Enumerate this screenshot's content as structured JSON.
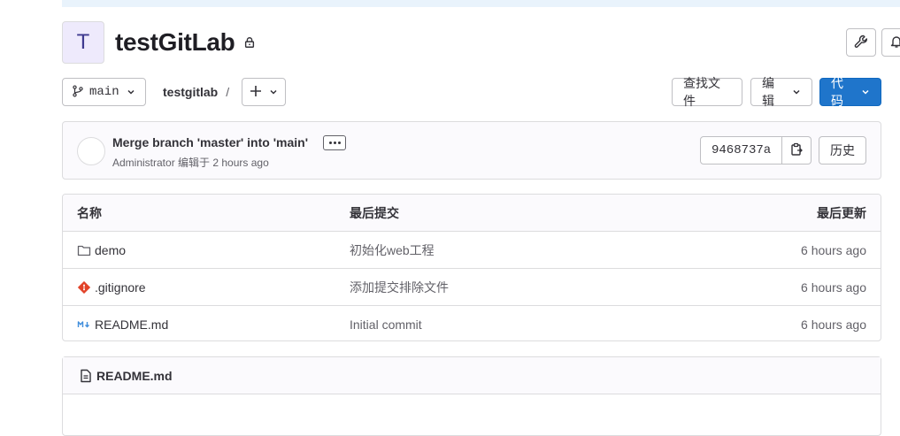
{
  "project": {
    "avatar_letter": "T",
    "title": "testGitLab",
    "visibility_icon": "lock-icon"
  },
  "header_actions": {
    "settings_icon": "wrench-icon",
    "notifications_icon": "bell-icon"
  },
  "toolbar": {
    "branch": "main",
    "breadcrumb": "testgitlab",
    "breadcrumb_sep": "/",
    "add_label": "+",
    "find_file": "查找文件",
    "edit": "编辑",
    "code": "代码"
  },
  "commit": {
    "title": "Merge branch 'master' into 'main'",
    "meta": "Administrator 编辑于 2 hours ago",
    "sha": "9468737a",
    "history": "历史"
  },
  "table": {
    "headers": {
      "name": "名称",
      "last_commit": "最后提交",
      "last_update": "最后更新"
    },
    "rows": [
      {
        "name": "demo",
        "icon": "folder-icon",
        "commit": "初始化web工程",
        "date": "6 hours ago"
      },
      {
        "name": ".gitignore",
        "icon": "git-icon",
        "commit": "添加提交排除文件",
        "date": "6 hours ago"
      },
      {
        "name": "README.md",
        "icon": "markdown-icon",
        "commit": "Initial commit",
        "date": "6 hours ago"
      }
    ]
  },
  "readme": {
    "title": "README.md"
  },
  "colors": {
    "primary": "#1f75cb",
    "git_orange": "#e24329",
    "markdown_blue": "#428fdc"
  }
}
